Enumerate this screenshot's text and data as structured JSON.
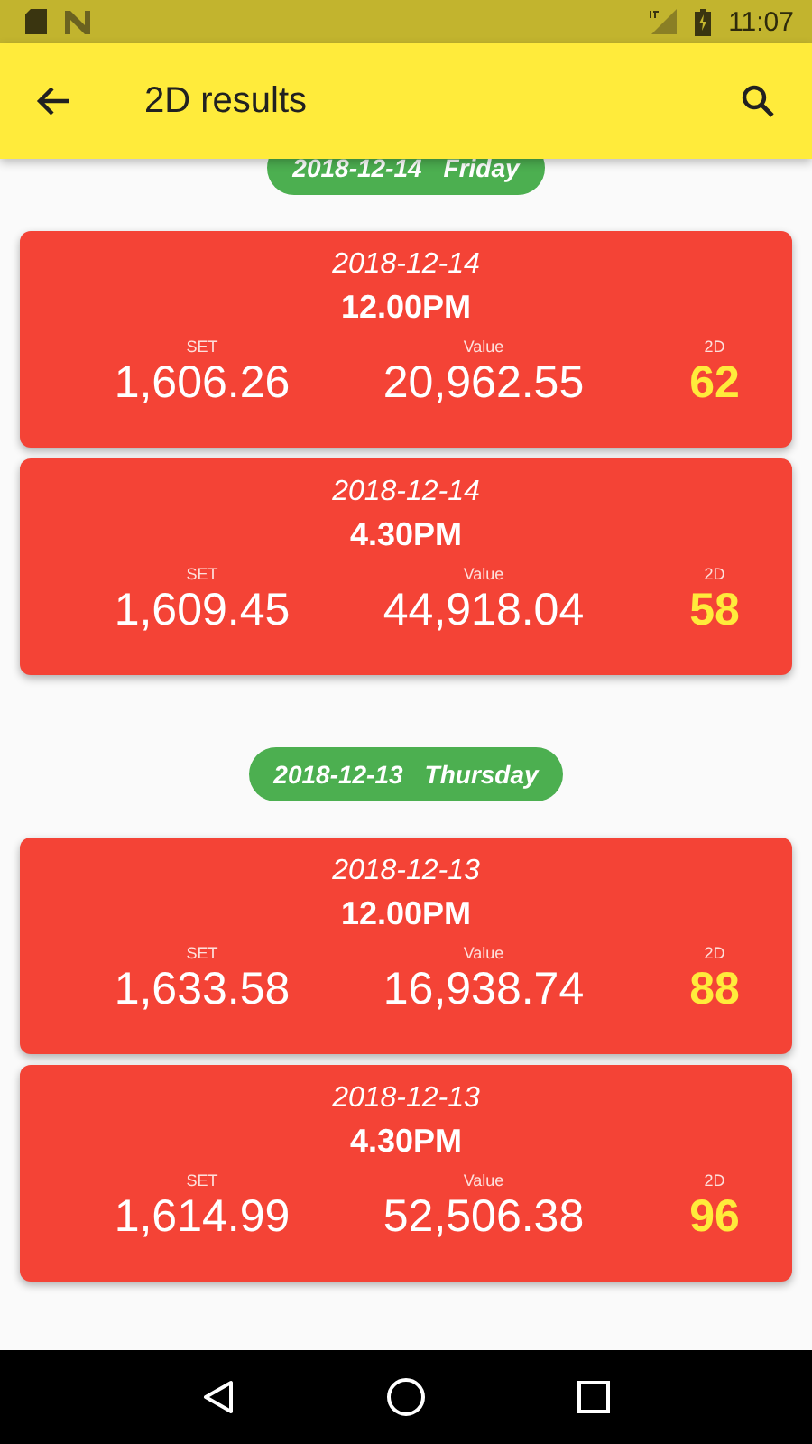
{
  "status_bar": {
    "time": "11:07"
  },
  "app_bar": {
    "title": "2D results"
  },
  "days": [
    {
      "date": "2018-12-14",
      "weekday": "Friday",
      "results": [
        {
          "date": "2018-12-14",
          "time": "12.00PM",
          "set_label": "SET",
          "set": "1,606.26",
          "value_label": "Value",
          "value": "20,962.55",
          "twod_label": "2D",
          "twod": "62"
        },
        {
          "date": "2018-12-14",
          "time": "4.30PM",
          "set_label": "SET",
          "set": "1,609.45",
          "value_label": "Value",
          "value": "44,918.04",
          "twod_label": "2D",
          "twod": "58"
        }
      ]
    },
    {
      "date": "2018-12-13",
      "weekday": "Thursday",
      "results": [
        {
          "date": "2018-12-13",
          "time": "12.00PM",
          "set_label": "SET",
          "set": "1,633.58",
          "value_label": "Value",
          "value": "16,938.74",
          "twod_label": "2D",
          "twod": "88"
        },
        {
          "date": "2018-12-13",
          "time": "4.30PM",
          "set_label": "SET",
          "set": "1,614.99",
          "value_label": "Value",
          "value": "52,506.38",
          "twod_label": "2D",
          "twod": "96"
        }
      ]
    }
  ]
}
